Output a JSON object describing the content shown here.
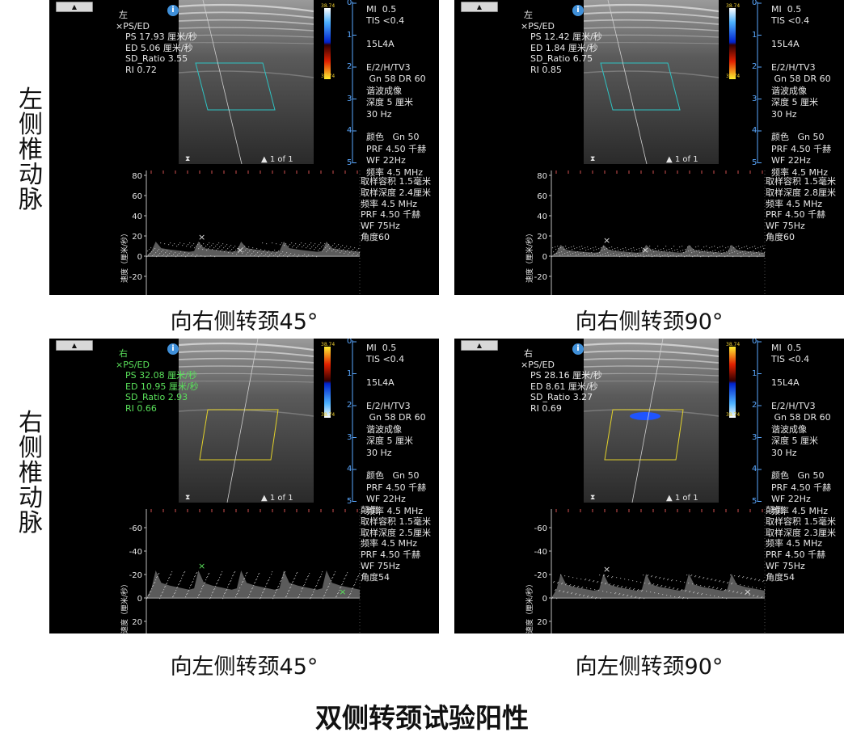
{
  "main_title": "双侧转颈试验阳性",
  "row_labels": [
    "左侧椎动脉",
    "右侧椎动脉"
  ],
  "captions": [
    "向右侧转颈45°",
    "向右侧转颈90°",
    "向左侧转颈45°",
    "向左侧转颈90°"
  ],
  "panels": [
    {
      "side": "左",
      "measurements": [
        "×PS/ED",
        "PS 17.93 厘米/秒",
        "ED 5.06 厘米/秒",
        "SD_Ratio 3.55",
        "RI 0.72"
      ],
      "meas_color": "white",
      "box_color": "#2ec3c3",
      "flow_color": "none",
      "colorbar": [
        "38.74",
        "38.74"
      ],
      "params": [
        "MI  0.5",
        "TIS <0.4",
        "",
        "15L4A",
        "",
        "E/2/H/TV3",
        " Gn 58 DR 60",
        "谐波成像",
        "深度 5 厘米",
        "30 Hz",
        "",
        "颜色   Gn 50",
        "PRF 4.50 千赫",
        "WF 22Hz",
        "频率 4.5 MHz"
      ],
      "doppler_params": [
        "取样容积 1.5毫米",
        "取样深度 2.4厘米",
        "频率 4.5 MHz",
        "PRF 4.50 千赫",
        "WF 75Hz",
        "角度60"
      ],
      "page": "1 of 1",
      "y_ticks": [
        "80",
        "60",
        "40",
        "20",
        "0",
        "-20"
      ],
      "y_axis_label": "速度（厘米/秒）"
    },
    {
      "side": "左",
      "measurements": [
        "×PS/ED",
        "PS 12.42 厘米/秒",
        "ED 1.84 厘米/秒",
        "SD_Ratio 6.75",
        "RI 0.85"
      ],
      "meas_color": "white",
      "box_color": "#2ec3c3",
      "flow_color": "none",
      "colorbar": [
        "38.74",
        "38.74"
      ],
      "params": [
        "MI  0.5",
        "TIS <0.4",
        "",
        "15L4A",
        "",
        "E/2/H/TV3",
        " Gn 58 DR 60",
        "谐波成像",
        "深度 5 厘米",
        "30 Hz",
        "",
        "颜色   Gn 50",
        "PRF 4.50 千赫",
        "WF 22Hz",
        "频率 4.5 MHz"
      ],
      "doppler_params": [
        "取样容积 1.5毫米",
        "取样深度 2.8厘米",
        "频率 4.5 MHz",
        "PRF 4.50 千赫",
        "WF 75Hz",
        "角度60"
      ],
      "page": "1 of 1",
      "y_ticks": [
        "80",
        "60",
        "40",
        "20",
        "0",
        "-20"
      ],
      "y_axis_label": "速度（厘米/秒）"
    },
    {
      "side": "右",
      "measurements": [
        "×PS/ED",
        "PS 32.08 厘米/秒",
        "ED 10.95 厘米/秒",
        "SD_Ratio 2.93",
        "RI 0.66"
      ],
      "meas_color": "green",
      "box_color": "#e2d12a",
      "flow_color": "none",
      "colorbar": [
        "38.74",
        "38.74"
      ],
      "params": [
        "MI  0.5",
        "TIS <0.4",
        "",
        "15L4A",
        "",
        "E/2/H/TV3",
        " Gn 58 DR 60",
        "谐波成像",
        "深度 5 厘米",
        "30 Hz",
        "",
        "颜色   Gn 50",
        "PRF 4.50 千赫",
        "WF 22Hz",
        "频率 4.5 MHz"
      ],
      "doppler_params": [
        "颠倒",
        "取样容积 1.5毫米",
        "取样深度 2.5厘米",
        "频率 4.5 MHz",
        "PRF 4.50 千赫",
        "WF 75Hz",
        "角度54"
      ],
      "page": "1 of 1",
      "y_ticks": [
        "-60",
        "-40",
        "-20",
        "0",
        "20"
      ],
      "y_axis_label": "速度（厘米/秒）"
    },
    {
      "side": "右",
      "measurements": [
        "×PS/ED",
        "PS 28.16 厘米/秒",
        "ED 8.61 厘米/秒",
        "SD_Ratio 3.27",
        "RI 0.69"
      ],
      "meas_color": "white",
      "box_color": "#e2d12a",
      "flow_color": "#1f54ff",
      "colorbar": [
        "38.74",
        "38.74"
      ],
      "params": [
        "MI  0.5",
        "TIS <0.4",
        "",
        "15L4A",
        "",
        "E/2/H/TV3",
        " Gn 58 DR 60",
        "谐波成像",
        "深度 5 厘米",
        "30 Hz",
        "",
        "颜色   Gn 50",
        "PRF 4.50 千赫",
        "WF 22Hz",
        "频率 4.5 MHz"
      ],
      "doppler_params": [
        "颠倒",
        "取样容积 1.5毫米",
        "取样深度 2.3厘米",
        "频率 4.5 MHz",
        "PRF 4.50 千赫",
        "WF 75Hz",
        "角度54"
      ],
      "page": "1 of 1",
      "y_ticks": [
        "-60",
        "-40",
        "-20",
        "0",
        "20"
      ],
      "y_axis_label": "速度（厘米/秒）"
    }
  ]
}
